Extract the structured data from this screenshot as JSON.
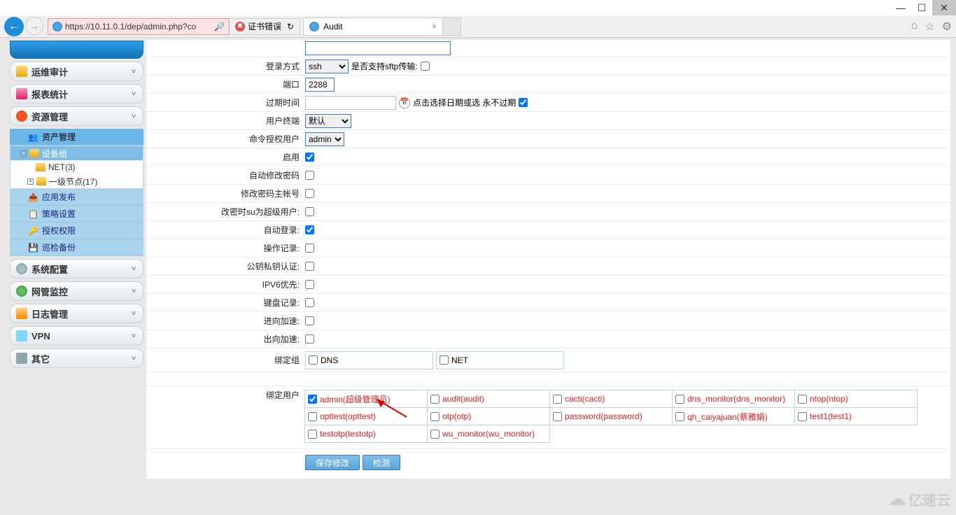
{
  "window": {
    "url": "https://10.11.0.1/dep/admin.php?co",
    "cert_error": "证书错误",
    "tab_title": "Audit"
  },
  "sidebar": {
    "groups": [
      {
        "label": "运维审计"
      },
      {
        "label": "报表统计"
      },
      {
        "label": "资源管理"
      },
      {
        "label": "系统配置"
      },
      {
        "label": "网管监控"
      },
      {
        "label": "日志管理"
      },
      {
        "label": "VPN"
      },
      {
        "label": "其它"
      }
    ],
    "res_sub": [
      {
        "label": "资产管理"
      },
      {
        "label": "应用发布"
      },
      {
        "label": "策略设置"
      },
      {
        "label": "授权权限"
      },
      {
        "label": "巡检备份"
      }
    ],
    "tree": {
      "root": "设备组",
      "net": "NET(3)",
      "node1": "一级节点(17)"
    }
  },
  "form": {
    "login_method": {
      "label": "登录方式",
      "value": "ssh",
      "sftp_label": "是否支持sftp传输:"
    },
    "port": {
      "label": "端口",
      "value": "2288"
    },
    "expire": {
      "label": "过期时间",
      "hint": "点击选择日期或选 永不过期"
    },
    "terminal": {
      "label": "用户终端",
      "value": "默认"
    },
    "cmd_user": {
      "label": "命令授权用户",
      "value": "admin"
    },
    "enable": {
      "label": "启用"
    },
    "auto_chpw": {
      "label": "自动修改密码"
    },
    "chpw_main": {
      "label": "修改密码主帐号"
    },
    "su_super": {
      "label": "改密时su为超级用户:"
    },
    "auto_login": {
      "label": "自动登录:"
    },
    "op_rec": {
      "label": "操作记录:"
    },
    "key_auth": {
      "label": "公钥私钥认证:"
    },
    "ipv6": {
      "label": "IPV6优先:"
    },
    "kb_rec": {
      "label": "键盘记录:"
    },
    "in_acc": {
      "label": "进向加速:"
    },
    "out_acc": {
      "label": "出向加速:"
    },
    "bind_group": {
      "label": "绑定组",
      "opts": [
        "DNS",
        "NET"
      ]
    },
    "bind_user": {
      "label": "绑定用户"
    }
  },
  "users": [
    "admin(超级管理员)",
    "audit(audit)",
    "cacti(cacti)",
    "dns_monitor(dns_monitor)",
    "ntop(ntop)",
    "opttest(opttest)",
    "otp(otp)",
    "password(password)",
    "qh_caiyajuan(蔡雅娟)",
    "test1(test1)",
    "testotp(testotp)",
    "wu_monitor(wu_monitor)"
  ],
  "buttons": {
    "save": "保存修改",
    "detect": "检测"
  },
  "watermark": "亿速云"
}
